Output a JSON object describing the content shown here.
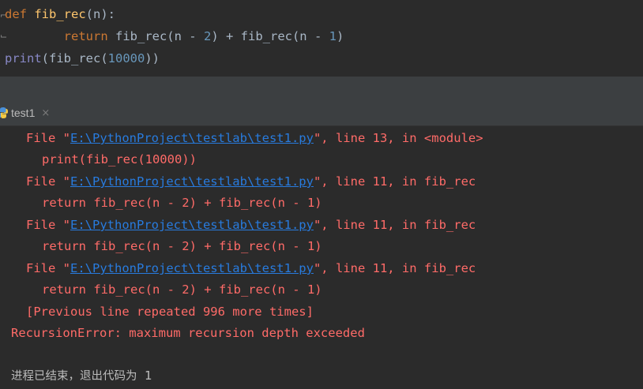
{
  "editor": {
    "line1": {
      "kw": "def",
      "fn": "fib_rec",
      "rest": "(n):"
    },
    "line2": {
      "kw": "return",
      "rest_a": " fib_rec(n - ",
      "n1": "2",
      "rest_b": ") + fib_rec(n - ",
      "n2": "1",
      "rest_c": ")"
    },
    "line3": {
      "builtin": "print",
      "rest_a": "(fib_rec(",
      "num": "10000",
      "rest_b": "))"
    }
  },
  "run_panel": {
    "tab_label": "test1",
    "tab_close": "×"
  },
  "console": {
    "tb1": {
      "pre": "File \"",
      "path": "E:\\PythonProject\\testlab\\test1.py",
      "post": "\", line 13, in <module>",
      "code": "print(fib_rec(10000))"
    },
    "tb2": {
      "pre": "File \"",
      "path": "E:\\PythonProject\\testlab\\test1.py",
      "post": "\", line 11, in fib_rec",
      "code": "return fib_rec(n - 2) + fib_rec(n - 1)"
    },
    "tb3": {
      "pre": "File \"",
      "path": "E:\\PythonProject\\testlab\\test1.py",
      "post": "\", line 11, in fib_rec",
      "code": "return fib_rec(n - 2) + fib_rec(n - 1)"
    },
    "tb4": {
      "pre": "File \"",
      "path": "E:\\PythonProject\\testlab\\test1.py",
      "post": "\", line 11, in fib_rec",
      "code": "return fib_rec(n - 2) + fib_rec(n - 1)"
    },
    "repeated": "[Previous line repeated 996 more times]",
    "error": "RecursionError: maximum recursion depth exceeded",
    "exit_text": "进程已结束，退出代码为",
    "exit_code": " 1"
  },
  "colors": {
    "background": "#2b2b2b",
    "error_text": "#ff6b68",
    "link": "#287bde",
    "keyword": "#cc7832",
    "function_name": "#ffc66d",
    "builtin": "#8888c6",
    "number": "#6897bb"
  },
  "icons": {
    "tab": "python-icon",
    "gutter": "fold-marker-icon"
  }
}
